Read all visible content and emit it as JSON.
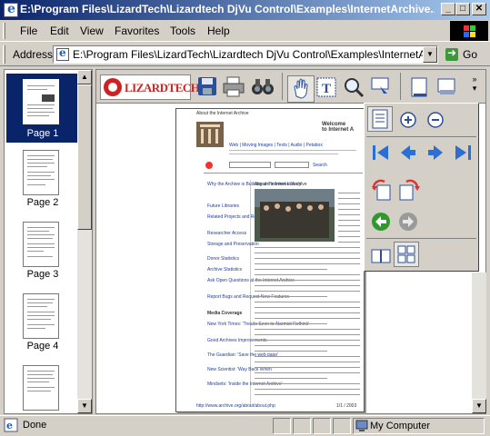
{
  "window": {
    "title": "E:\\Program Files\\LizardTech\\Lizardtech DjVu Control\\Examples\\InternetArchive...",
    "minimize": "_",
    "maximize": "□",
    "close": "✕"
  },
  "menu": {
    "items": [
      "File",
      "Edit",
      "View",
      "Favorites",
      "Tools",
      "Help"
    ]
  },
  "address": {
    "label": "Address",
    "value": "E:\\Program Files\\LizardTech\\Lizardtech DjVu Control\\Examples\\InternetArchive.c",
    "go_label": "Go"
  },
  "thumbnails": {
    "pages": [
      "Page 1",
      "Page 2",
      "Page 3",
      "Page 4"
    ],
    "selected_index": 0
  },
  "djvu_toolbar": {
    "logo_text": "LIZARDTECH"
  },
  "document": {
    "header": "About the Internet Archive",
    "welcome": "Welcome",
    "welcome_sub": "to Internet A",
    "search_button": "Search",
    "nav_text": "Web | Moving Images | Texts | Audio | Petabox",
    "intro_title": "About the Internet Archive",
    "sidebar_links": [
      "Why the Archive is Building an 'Internet Library'",
      "Future Libraries",
      "Related Projects and Research",
      "Researcher Access",
      "Storage and Preservation",
      "Donor Statistics",
      "Archive Statistics",
      "Ask Open Questions at the Internet Archive",
      "Report Bugs and Request New Features"
    ],
    "coverage_title": "Media Coverage",
    "coverage_links": [
      "New York Times: 'Treads Seen to Alarmist Rethink'",
      "Good Archives Improvements",
      "The Guardian: 'Save the web page'",
      "New Scientist: 'Way Back When'",
      "Mindsets: 'Inside the Internet Archive'"
    ],
    "footer_url": "http://www.archive.org/about/about.php",
    "footer_page": "1/1 / 2003"
  },
  "status": {
    "text": "Done",
    "zone": "My Computer"
  },
  "colors": {
    "title_gradient_start": "#0a246a",
    "title_gradient_end": "#a6caf0",
    "thumb_selected": "#0a246a",
    "link": "#1a3fa6"
  }
}
